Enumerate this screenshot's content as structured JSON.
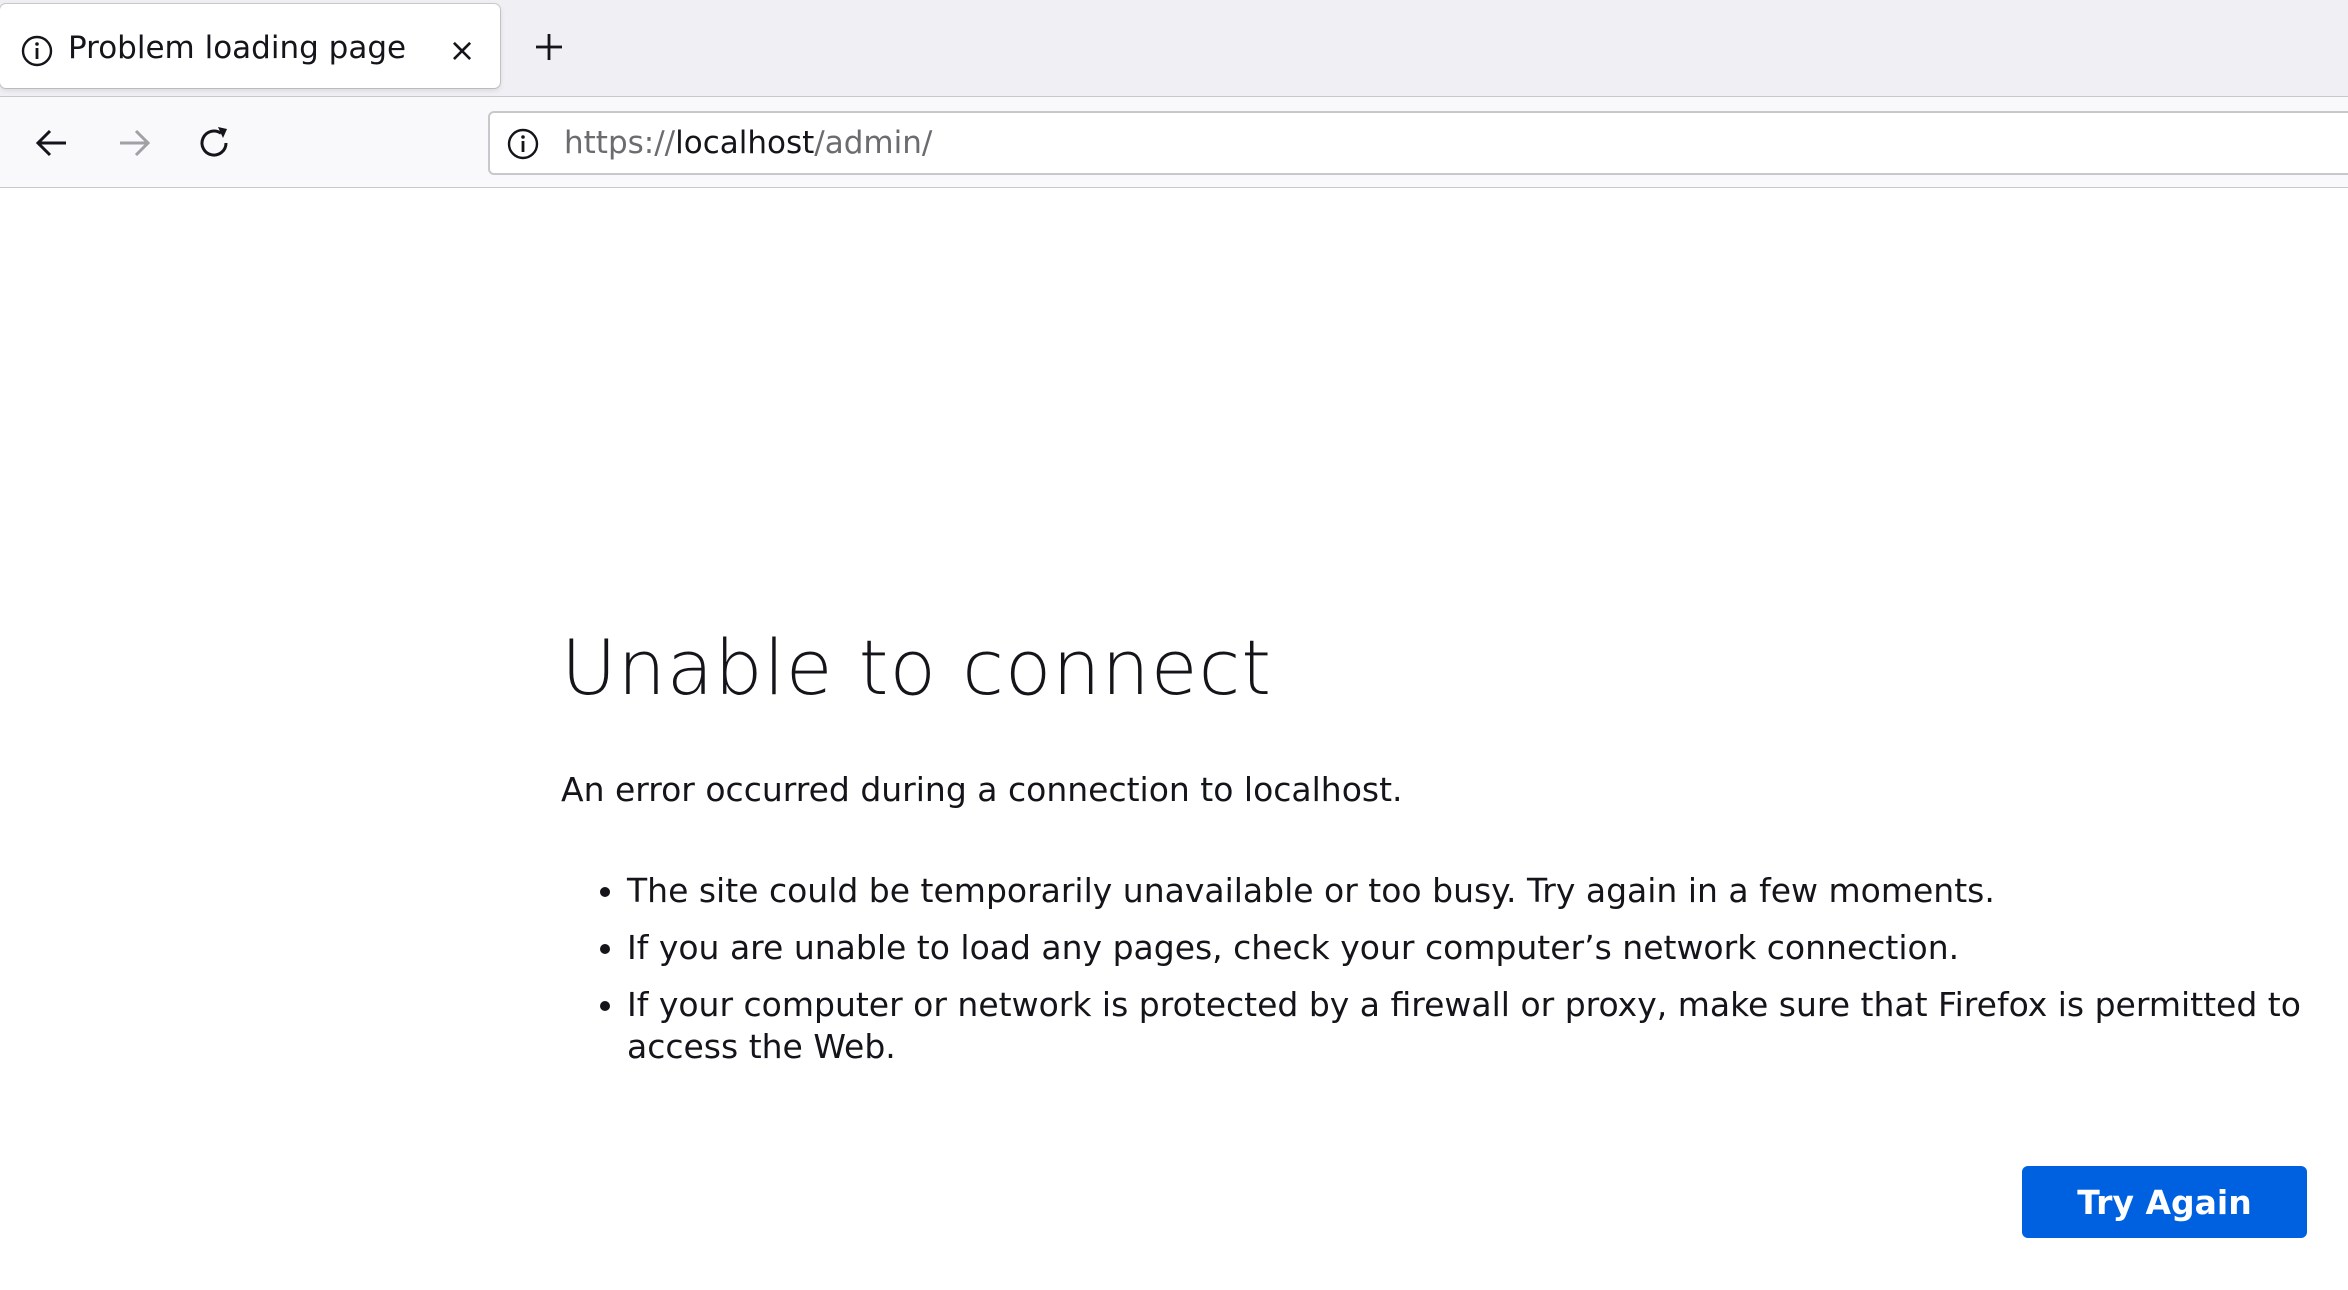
{
  "tab": {
    "title": "Problem loading page",
    "close_glyph": "×",
    "icon": "info-icon"
  },
  "newtab": {
    "glyph": "+"
  },
  "nav": {
    "back_icon": "back-arrow-icon",
    "forward_icon": "forward-arrow-icon",
    "reload_icon": "reload-icon"
  },
  "urlbar": {
    "scheme": "https://",
    "host": "localhost",
    "path": "/admin/",
    "icon": "info-icon"
  },
  "error": {
    "title": "Unable to connect",
    "description": "An error occurred during a connection to localhost.",
    "items": [
      "The site could be temporarily unavailable or too busy. Try again in a few moments.",
      "If you are unable to load any pages, check your computer’s network connection.",
      "If your computer or network is protected by a firewall or proxy, make sure that Firefox is permitted to access the Web."
    ],
    "button_label": "Try Again"
  },
  "colors": {
    "accent": "#0061e0",
    "tabstrip_bg": "#f0f0f4",
    "toolbar_bg": "#f9f9fb",
    "text": "#15141a",
    "dim_text": "#6c6c70"
  }
}
